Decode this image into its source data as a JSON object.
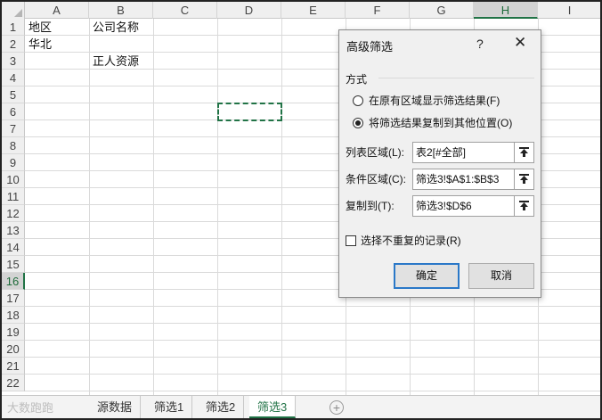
{
  "sheet": {
    "columns": [
      "A",
      "B",
      "C",
      "D",
      "E",
      "F",
      "G",
      "H",
      "I"
    ],
    "selected_column": "H",
    "rows": [
      "1",
      "2",
      "3",
      "4",
      "5",
      "6",
      "7",
      "8",
      "9",
      "10",
      "11",
      "12",
      "13",
      "14",
      "15",
      "16",
      "17",
      "18",
      "19",
      "20",
      "21",
      "22"
    ],
    "selected_row": "16",
    "cells": {
      "a1": "地区",
      "b1": "公司名称",
      "a2": "华北",
      "b3": "正人资源"
    }
  },
  "tabs": {
    "watermark": "大数跑跑",
    "items": [
      {
        "label": "源数据"
      },
      {
        "label": "筛选1"
      },
      {
        "label": "筛选2"
      },
      {
        "label": "筛选3"
      }
    ],
    "active": "筛选3",
    "add_icon": "plus-circle-icon"
  },
  "dialog": {
    "title": "高级筛选",
    "help": "?",
    "close": "✕",
    "mode_label": "方式",
    "option_inplace": "在原有区域显示筛选结果(F)",
    "option_copy": "将筛选结果复制到其他位置(O)",
    "selected_option": "copy",
    "list_range_label": "列表区域(L):",
    "list_range_value": "表2[#全部]",
    "criteria_label": "条件区域(C):",
    "criteria_value": "筛选3!$A$1:$B$3",
    "copy_to_label": "复制到(T):",
    "copy_to_value": "筛选3!$D$6",
    "unique_label": "选择不重复的记录(R)",
    "unique_checked": false,
    "ok": "确定",
    "cancel": "取消",
    "accent_color": "#2a78c8"
  },
  "colors": {
    "excel_green": "#217346"
  }
}
